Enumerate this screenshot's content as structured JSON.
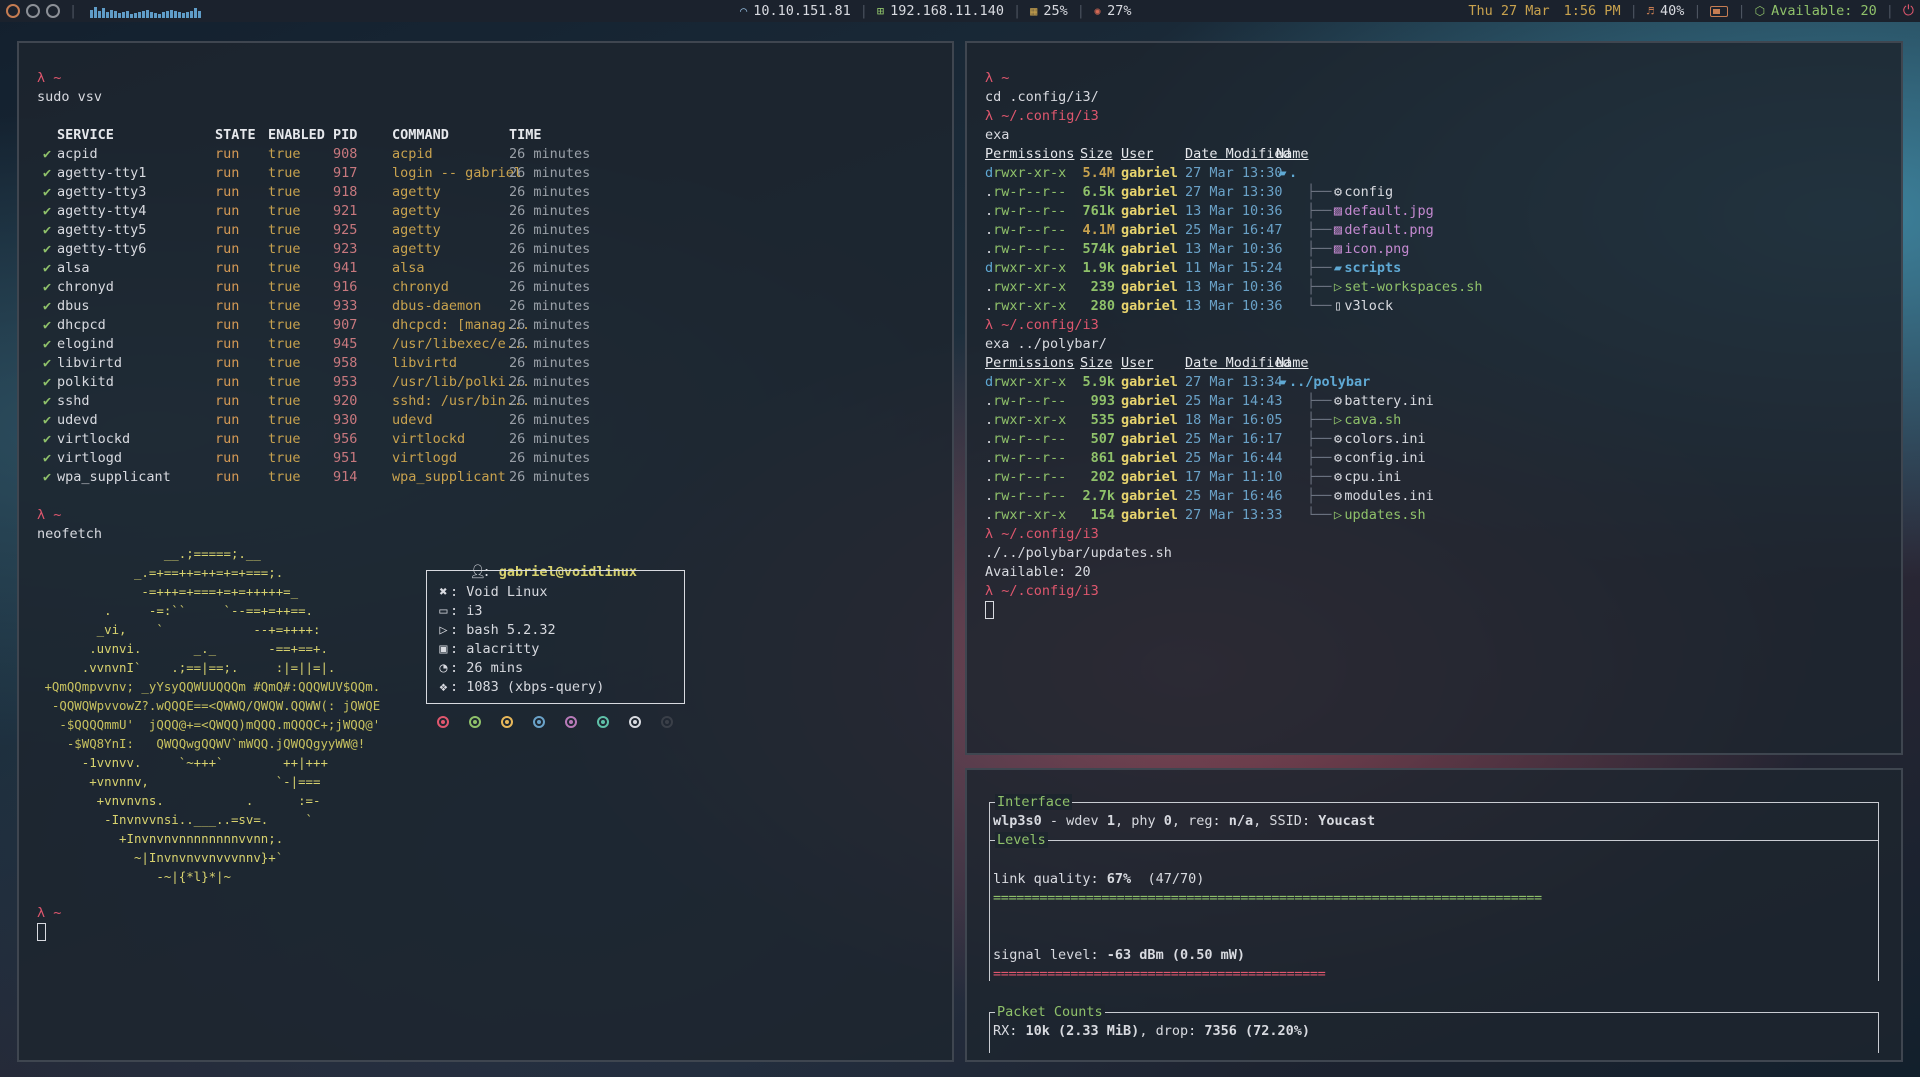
{
  "bar": {
    "wifi_ip": "10.10.151.81",
    "lan_ip": "192.168.11.140",
    "mem": "25%",
    "cpu": "27%",
    "date": "Thu 27 Mar",
    "time": "1:56 PM",
    "volume": "40%",
    "updates": "Available: 20",
    "cava_levels": [
      0.7,
      0.9,
      0.6,
      0.8,
      0.5,
      0.7,
      0.6,
      0.4,
      0.5,
      0.6,
      0.3,
      0.4,
      0.5,
      0.6,
      0.7,
      0.5,
      0.4,
      0.3,
      0.5,
      0.6,
      0.7,
      0.6,
      0.5,
      0.4,
      0.5,
      0.6,
      0.8,
      0.6
    ]
  },
  "left": {
    "prompt1": "λ ~",
    "cmd1": "sudo vsv",
    "headers": [
      "SERVICE",
      "STATE",
      "ENABLED",
      "PID",
      "COMMAND",
      "TIME"
    ],
    "services": [
      {
        "name": "acpid",
        "state": "run",
        "enabled": "true",
        "pid": "908",
        "command": "acpid",
        "time": "26 minutes"
      },
      {
        "name": "agetty-tty1",
        "state": "run",
        "enabled": "true",
        "pid": "917",
        "command": "login -- gabriel",
        "time": "26 minutes"
      },
      {
        "name": "agetty-tty3",
        "state": "run",
        "enabled": "true",
        "pid": "918",
        "command": "agetty",
        "time": "26 minutes"
      },
      {
        "name": "agetty-tty4",
        "state": "run",
        "enabled": "true",
        "pid": "921",
        "command": "agetty",
        "time": "26 minutes"
      },
      {
        "name": "agetty-tty5",
        "state": "run",
        "enabled": "true",
        "pid": "925",
        "command": "agetty",
        "time": "26 minutes"
      },
      {
        "name": "agetty-tty6",
        "state": "run",
        "enabled": "true",
        "pid": "923",
        "command": "agetty",
        "time": "26 minutes"
      },
      {
        "name": "alsa",
        "state": "run",
        "enabled": "true",
        "pid": "941",
        "command": "alsa",
        "time": "26 minutes"
      },
      {
        "name": "chronyd",
        "state": "run",
        "enabled": "true",
        "pid": "916",
        "command": "chronyd",
        "time": "26 minutes"
      },
      {
        "name": "dbus",
        "state": "run",
        "enabled": "true",
        "pid": "933",
        "command": "dbus-daemon",
        "time": "26 minutes"
      },
      {
        "name": "dhcpcd",
        "state": "run",
        "enabled": "true",
        "pid": "907",
        "command": "dhcpcd: [manag...",
        "time": "26 minutes"
      },
      {
        "name": "elogind",
        "state": "run",
        "enabled": "true",
        "pid": "945",
        "command": "/usr/libexec/e...",
        "time": "26 minutes"
      },
      {
        "name": "libvirtd",
        "state": "run",
        "enabled": "true",
        "pid": "958",
        "command": "libvirtd",
        "time": "26 minutes"
      },
      {
        "name": "polkitd",
        "state": "run",
        "enabled": "true",
        "pid": "953",
        "command": "/usr/lib/polki...",
        "time": "26 minutes"
      },
      {
        "name": "sshd",
        "state": "run",
        "enabled": "true",
        "pid": "920",
        "command": "sshd: /usr/bin...",
        "time": "26 minutes"
      },
      {
        "name": "udevd",
        "state": "run",
        "enabled": "true",
        "pid": "930",
        "command": "udevd",
        "time": "26 minutes"
      },
      {
        "name": "virtlockd",
        "state": "run",
        "enabled": "true",
        "pid": "956",
        "command": "virtlockd",
        "time": "26 minutes"
      },
      {
        "name": "virtlogd",
        "state": "run",
        "enabled": "true",
        "pid": "951",
        "command": "virtlogd",
        "time": "26 minutes"
      },
      {
        "name": "wpa_supplicant",
        "state": "run",
        "enabled": "true",
        "pid": "914",
        "command": "wpa_supplicant",
        "time": "26 minutes"
      }
    ],
    "prompt2": "λ ~",
    "cmd2": "neofetch",
    "logo": [
      "                 __.;=====;.__",
      "             _.=+==++=++=+=+===;.",
      "              -=+++=+===+=+=+++++=_",
      "         .     -=:``     `--==+=++==.",
      "        _vi,    `            --+=++++:",
      "       .uvnvi.       _._       -==+==+.",
      "      .vvnvnI`    .;==|==;.     :|=||=|.",
      " +QmQQmpvvnv; _yYsyQQWUUQQQm #QmQ#:QQQWUV$QQm.",
      "  -QQWQWpvvowZ?.wQQQE==<QWWQ/QWQW.QQWW(: jQWQE",
      "   -$QQQQmmU'  jQQQ@+=<QWQQ)mQQQ.mQQQC+;jWQQ@'",
      "    -$WQ8YnI:   QWQQwgQQWV`mWQQ.jQWQQgyyWW@!",
      "      -1vvnvv.     `~+++`        ++|+++",
      "       +vnvnnv,                 `-|===",
      "        +vnvnvns.           .      :=-",
      "         -Invnvvnsi..___..=sv=.     `",
      "           +Invnvnvnnnnnnnnvvnn;.",
      "             ~|Invnvnvvnvvvnnv}+`",
      "                -~|{*l}*|~"
    ],
    "info": {
      "user": "gabriel@voidlinux",
      "os": "Void Linux",
      "wm": "i3",
      "shell": "bash 5.2.32",
      "terminal": "alacritty",
      "uptime": "26 mins",
      "packages": "1083 (xbps-query)",
      "colon": ":"
    },
    "palette": [
      "#e0576e",
      "#8fc16a",
      "#e8b85a",
      "#6aa2c8",
      "#b87ab8",
      "#5fc0a8",
      "#d8dae0",
      "#3a3f48"
    ],
    "prompt3": "λ ~"
  },
  "tr": {
    "p1": "λ ~",
    "c1": "cd .config/i3/",
    "p2": "λ ~/.config/i3",
    "c2": "exa",
    "headers": [
      "Permissions",
      "Size",
      "User",
      "Date Modified",
      "Name"
    ],
    "rows1": [
      {
        "type": "d",
        "perm": "rwxr-xr-x",
        "size": "5.4M",
        "user": "gabriel",
        "date": "27 Mar 13:30",
        "name": ".",
        "kind": "dir",
        "tree": ""
      },
      {
        "type": ".",
        "perm": "rw-r--r--",
        "size": "6.5k",
        "user": "gabriel",
        "date": "27 Mar 13:30",
        "name": "config",
        "kind": "cfg",
        "tree": "├──"
      },
      {
        "type": ".",
        "perm": "rw-r--r--",
        "size": "761k",
        "user": "gabriel",
        "date": "13 Mar 10:36",
        "name": "default.jpg",
        "kind": "img",
        "tree": "├──"
      },
      {
        "type": ".",
        "perm": "rw-r--r--",
        "size": "4.1M",
        "user": "gabriel",
        "date": "25 Mar 16:47",
        "name": "default.png",
        "kind": "img",
        "tree": "├──"
      },
      {
        "type": ".",
        "perm": "rw-r--r--",
        "size": "574k",
        "user": "gabriel",
        "date": "13 Mar 10:36",
        "name": "icon.png",
        "kind": "img",
        "tree": "├──"
      },
      {
        "type": "d",
        "perm": "rwxr-xr-x",
        "size": "1.9k",
        "user": "gabriel",
        "date": "11 Mar 15:24",
        "name": "scripts",
        "kind": "dir",
        "tree": "├──"
      },
      {
        "type": ".",
        "perm": "rwxr-xr-x",
        "size": "239",
        "user": "gabriel",
        "date": "13 Mar 10:36",
        "name": "set-workspaces.sh",
        "kind": "sh",
        "tree": "├──"
      },
      {
        "type": ".",
        "perm": "rwxr-xr-x",
        "size": "280",
        "user": "gabriel",
        "date": "13 Mar 10:36",
        "name": "v3lock",
        "kind": "file",
        "tree": "└──"
      }
    ],
    "p3": "λ ~/.config/i3",
    "c3": "exa ../polybar/",
    "rows2": [
      {
        "type": "d",
        "perm": "rwxr-xr-x",
        "size": "5.9k",
        "user": "gabriel",
        "date": "27 Mar 13:34",
        "name": "../polybar",
        "kind": "dir",
        "tree": ""
      },
      {
        "type": ".",
        "perm": "rw-r--r--",
        "size": "993",
        "user": "gabriel",
        "date": "25 Mar 14:43",
        "name": "battery.ini",
        "kind": "cfg",
        "tree": "├──"
      },
      {
        "type": ".",
        "perm": "rwxr-xr-x",
        "size": "535",
        "user": "gabriel",
        "date": "18 Mar 16:05",
        "name": "cava.sh",
        "kind": "sh",
        "tree": "├──"
      },
      {
        "type": ".",
        "perm": "rw-r--r--",
        "size": "507",
        "user": "gabriel",
        "date": "25 Mar 16:17",
        "name": "colors.ini",
        "kind": "cfg",
        "tree": "├──"
      },
      {
        "type": ".",
        "perm": "rw-r--r--",
        "size": "861",
        "user": "gabriel",
        "date": "25 Mar 16:44",
        "name": "config.ini",
        "kind": "cfg",
        "tree": "├──"
      },
      {
        "type": ".",
        "perm": "rw-r--r--",
        "size": "202",
        "user": "gabriel",
        "date": "17 Mar 11:10",
        "name": "cpu.ini",
        "kind": "cfg",
        "tree": "├──"
      },
      {
        "type": ".",
        "perm": "rw-r--r--",
        "size": "2.7k",
        "user": "gabriel",
        "date": "25 Mar 16:46",
        "name": "modules.ini",
        "kind": "cfg",
        "tree": "├──"
      },
      {
        "type": ".",
        "perm": "rwxr-xr-x",
        "size": "154",
        "user": "gabriel",
        "date": "27 Mar 13:33",
        "name": "updates.sh",
        "kind": "sh",
        "tree": "└──"
      }
    ],
    "p4": "λ ~/.config/i3",
    "c4": "./../polybar/updates.sh",
    "out4": "Available: 20",
    "p5": "λ ~/.config/i3"
  },
  "br": {
    "t_interface": "Interface",
    "iface": "wlp3s0",
    "iface_rest": " - wdev ",
    "wdev": "1",
    "phy_label": ", phy ",
    "phy": "0",
    "reg_label": ", reg: ",
    "reg": "n/a",
    "ssid_label": ", SSID: ",
    "ssid": "Youcast",
    "t_levels": "Levels",
    "lq_label": "link quality: ",
    "lq": "67%",
    "lq_rest": "  (47/70)",
    "lq_fraction": 0.67,
    "sig_label": "signal level: ",
    "sig": "-63 dBm (0.50 mW)",
    "sig_fraction": 0.41,
    "t_packets": "Packet Counts",
    "rx_label": "RX: ",
    "rx": "10k (2.33 MiB)",
    "drop_label": ", drop: ",
    "drop": "7356 (72.20%)"
  }
}
